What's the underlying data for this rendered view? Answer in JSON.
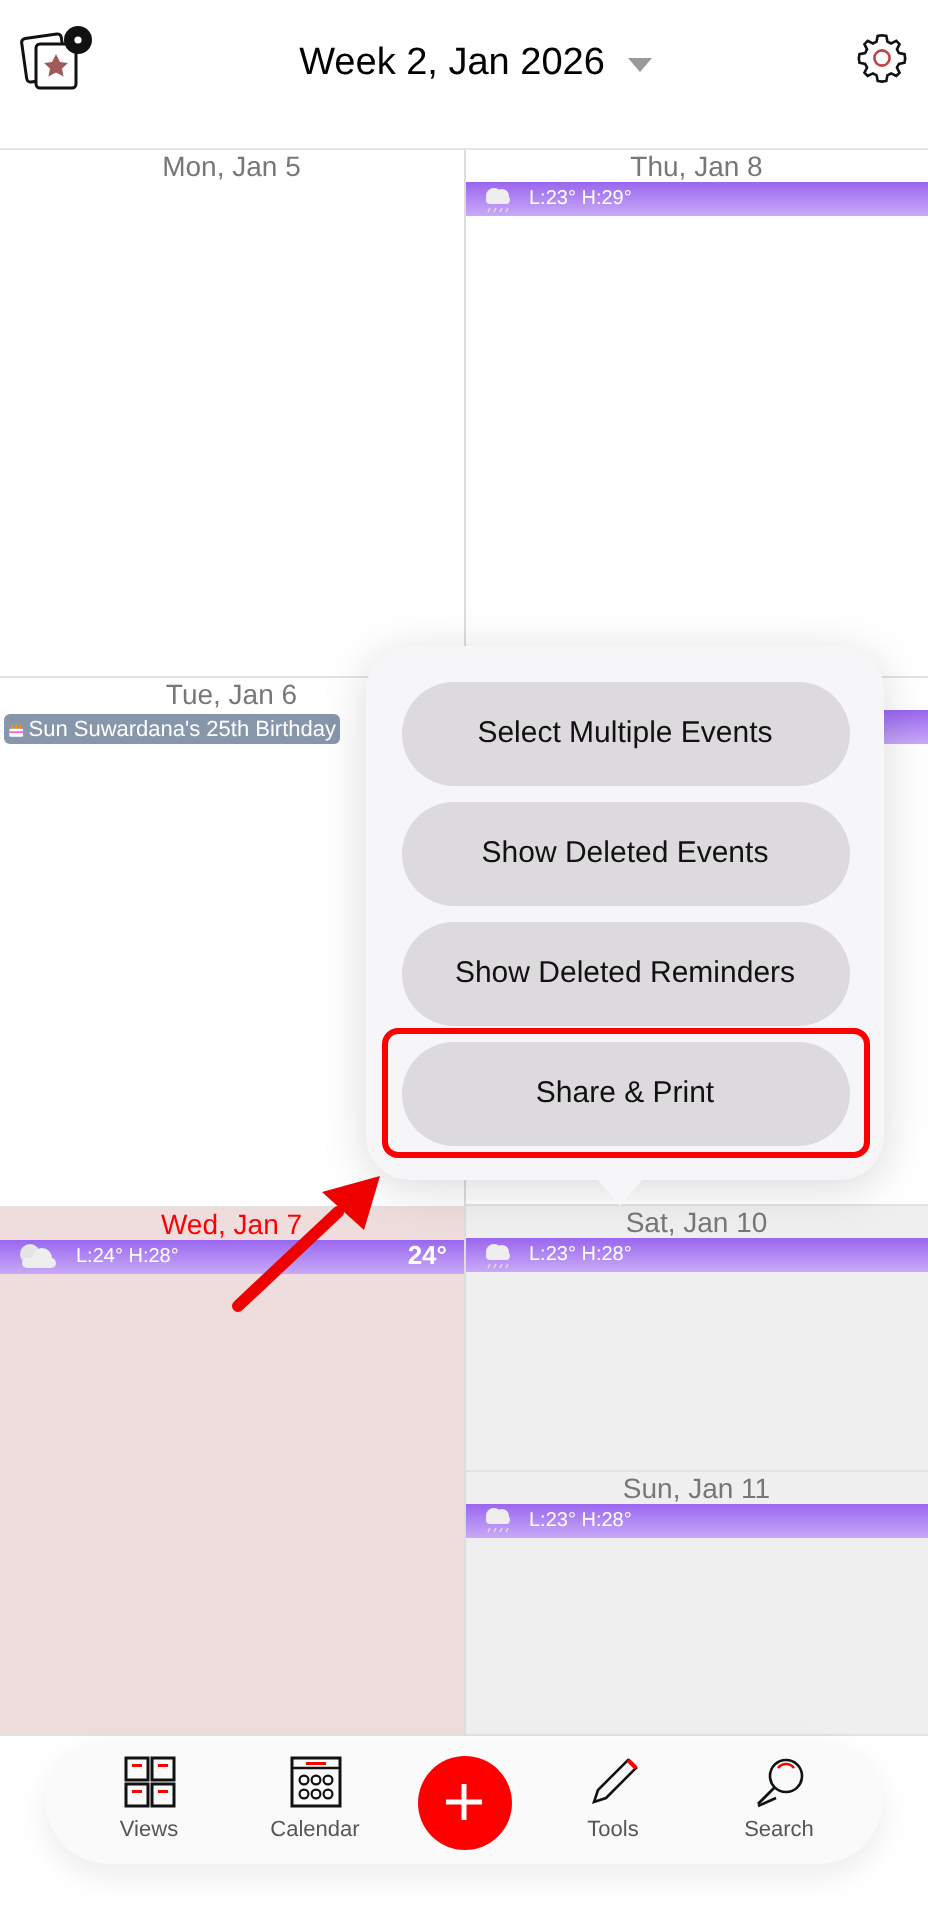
{
  "header": {
    "title": "Week 2, Jan 2026"
  },
  "columns": [
    [
      {
        "date": "Mon, Jan 5",
        "today": false
      },
      {
        "date": "Tue, Jan 6",
        "today": false,
        "events": [
          {
            "title": "Sun Suwardana's 25th Birthday",
            "kind": "birthday"
          }
        ]
      },
      {
        "date": "Wed, Jan 7",
        "today": true,
        "weather": {
          "range": "L:24° H:28°",
          "current": "24°",
          "kind": "cloudy"
        }
      }
    ],
    [
      {
        "date": "Thu, Jan 8",
        "today": false,
        "weather": {
          "range": "L:23° H:29°",
          "kind": "rain"
        }
      },
      {
        "today": false,
        "weather": {
          "kind": "hidden"
        }
      },
      {
        "date": "Sat, Jan 10",
        "today": false,
        "weather": {
          "range": "L:23° H:28°",
          "kind": "rain"
        }
      },
      {
        "date": "Sun, Jan 11",
        "today": false,
        "weather": {
          "range": "L:23° H:28°",
          "kind": "rain"
        }
      }
    ]
  ],
  "menu": {
    "items": [
      {
        "label": "Select Multiple Events",
        "selected": false
      },
      {
        "label": "Show Deleted Events",
        "selected": false
      },
      {
        "label": "Show Deleted Reminders",
        "selected": false
      },
      {
        "label": "Share & Print",
        "selected": true
      }
    ]
  },
  "tab_bar": [
    {
      "label": "Views",
      "kind": "views"
    },
    {
      "label": "Calendar",
      "kind": "calendar"
    },
    {
      "kind": "add"
    },
    {
      "label": "Tools",
      "kind": "tools"
    },
    {
      "label": "Search",
      "kind": "search"
    }
  ]
}
